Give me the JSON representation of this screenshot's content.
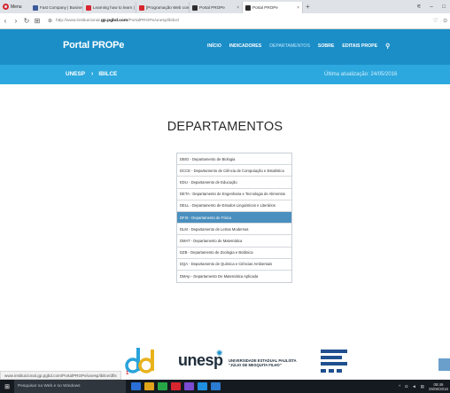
{
  "browser": {
    "menu_label": "Menu",
    "tabs": [
      {
        "title": "Fast Company | Business + ",
        "color": "#3b5a9a"
      },
      {
        "title": "Learning how to learn | Bu ",
        "color": "#d7262f"
      },
      {
        "title": "[Programação Web com J...",
        "color": "#d7262f"
      },
      {
        "title": "Portal PROPe",
        "color": "#2d2d2d"
      },
      {
        "title": "Portal PROPe",
        "color": "#2d2d2d",
        "active": true
      }
    ],
    "new_tab": "+",
    "url_prefix": "http://www.instituicional.",
    "url_domain": "gp.pgbd.com",
    "url_path": "/PortalPROPe/unesp/ibilce/"
  },
  "site": {
    "logo": "Portal PROPe",
    "nav": [
      "INÍCIO",
      "INDICADORES",
      "DEPARTAMENTOS",
      "SOBRE",
      "EDITAIS PROPE"
    ],
    "breadcrumb": {
      "root": "UNESP",
      "sep": "›",
      "current": "IBILCE"
    },
    "updated": "Última atualização: 24/05/2016"
  },
  "main": {
    "title": "DEPARTAMENTOS",
    "departments": [
      "DBIO - Departamento de Biologia",
      "DCCE - Departamento de Ciência de Computação e Estatística",
      "EDU - Departamento de Educação",
      "DETA - Departamento de Engenharia e Tecnologia de Alimentos",
      "DELL - Departamento de Estudos Linguísticos e Literários",
      "DFIS - Departamento de Física",
      "DLM - Departamento de Letras Modernas",
      "DMAT - Departamento de Matemática",
      "DZB - Departamento de Zoologia e Botânica",
      "DQA - Departamento de Química e Ciências Ambientais",
      "DMAp - Departamento De Matemática Aplicada"
    ],
    "active_index": 5
  },
  "footer": {
    "unesp_logo": "unesp",
    "unesp_line1": "UNIVERSIDADE ESTADUAL PAULISTA",
    "unesp_line2": "\"JÚLIO DE MESQUITA FILHO\""
  },
  "status_url": "www.instituicional.gp.pgbd.com/PortalPROPe/unesp/ibilce/dfis",
  "taskbar": {
    "search_placeholder": "Pesquisar na Web e no Windows",
    "apps": [
      "#2a6fd6",
      "#e0a41a",
      "#27a745",
      "#d7262f",
      "#7b4bd1",
      "#1f8fe0",
      "#2b7bd3"
    ],
    "clock_time": "08:46",
    "clock_date": "25/06/2016"
  }
}
